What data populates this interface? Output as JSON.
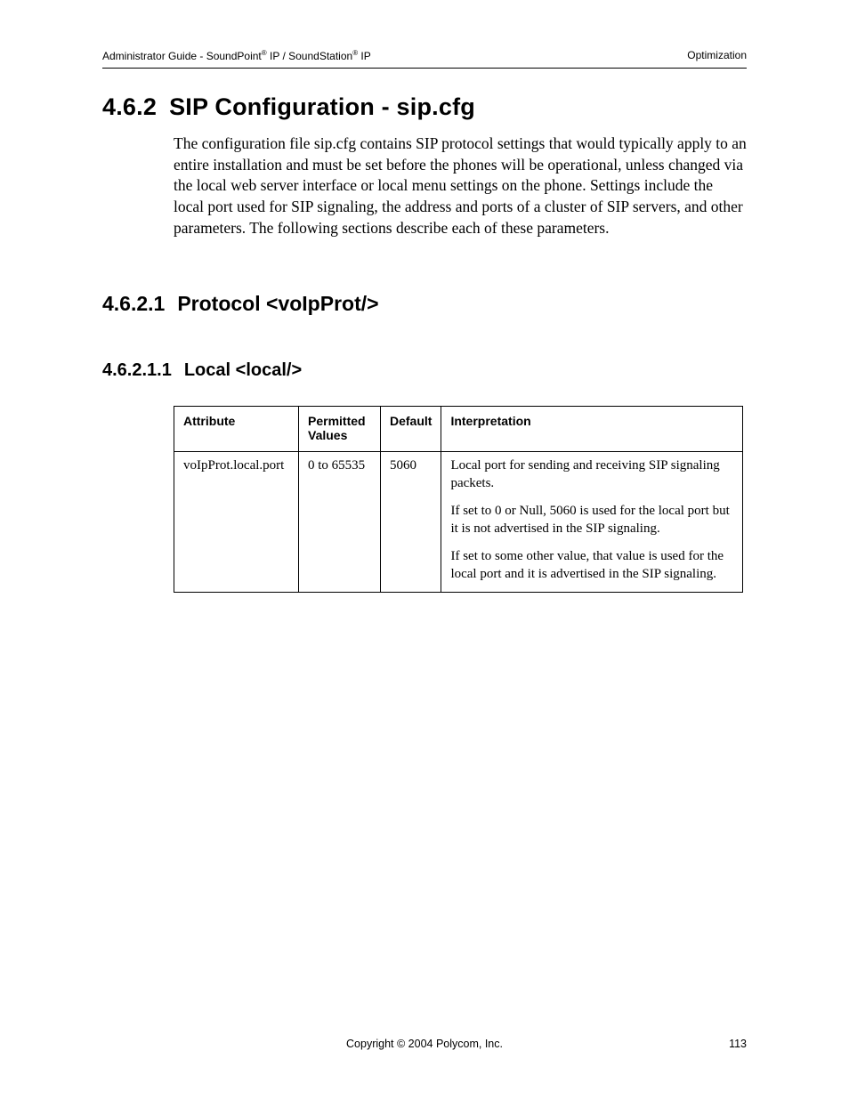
{
  "header": {
    "left_pre": "Administrator Guide - SoundPoint",
    "left_mid": " IP / SoundStation",
    "left_suf": " IP",
    "right": "Optimization"
  },
  "h1": {
    "num": "4.6.2",
    "title": "SIP Configuration - sip.cfg"
  },
  "para": "The configuration file sip.cfg contains SIP protocol settings that would typically apply to an entire installation and must be set before the phones will be operational, unless changed via the local web server interface or local menu settings on the phone.  Settings include the local port used for SIP signaling, the address and ports of a cluster of SIP servers, and other parameters.  The following sections describe each of these parameters.",
  "h2": {
    "num": "4.6.2.1",
    "title": "Protocol <voIpProt/>"
  },
  "h3": {
    "num": "4.6.2.1.1",
    "title": "Local <local/>"
  },
  "table": {
    "headers": {
      "attribute": "Attribute",
      "permitted": "Permitted Values",
      "default": "Default",
      "interpretation": "Interpretation"
    },
    "row": {
      "attribute": "voIpProt.local.port",
      "permitted": "0 to 65535",
      "default": "5060",
      "interp1": "Local port for sending and receiving SIP signaling packets.",
      "interp2": "If set to 0 or Null, 5060 is used for the local port but it is not advertised in the SIP signaling.",
      "interp3": "If set to some other value, that value is used for the local port and it is advertised in the SIP signaling."
    }
  },
  "footer": {
    "copyright": "Copyright © 2004 Polycom, Inc.",
    "page": "113"
  }
}
